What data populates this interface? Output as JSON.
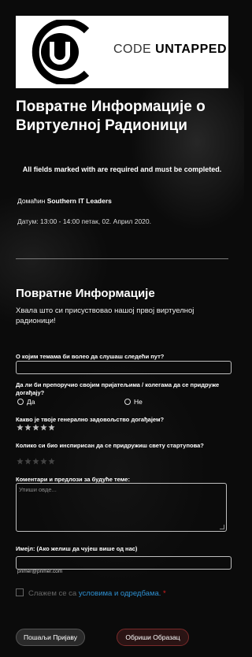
{
  "logo": {
    "word1": "CODE ",
    "word2": "UNTAPPED",
    "mark_letter": "U"
  },
  "header": {
    "title": "Повратне Информације о Виртуелној Радионици",
    "required_note": "All fields marked with are required and must be completed."
  },
  "event": {
    "host_prefix": "Домаћин ",
    "host_name": "Southern IT Leaders",
    "date": "Датум: 13:00 - 14:00 петак, 02. Април 2020."
  },
  "section": {
    "title": "Повратне Информације",
    "description": "Хвала што си присуствовао нашој првој виртуелној радионици!"
  },
  "questions": {
    "topics_label": "О којим темама би волео да слушаш следећи пут?",
    "topics_value": "",
    "recommend_label": "Да ли би препоручио својим пријатељима / колегама да се придруже догађају?",
    "recommend_options": [
      "Да",
      "Не"
    ],
    "satisfaction_label": "Какво је твоје генерално задовољство догађајем?",
    "satisfaction_rating": 5,
    "inspired_label": "Колико си био инспирисан да се придружиш свету стартупова?",
    "inspired_rating": 0,
    "comments_label": "Коментари и предлози за будуће теме:",
    "comments_placeholder": "Упиши овде...",
    "email_label": "Имејл: (Ако желиш да чујеш више од нас)",
    "email_value": "",
    "email_sublabel": "primer@primer.com"
  },
  "agreement": {
    "text": "Слажем се са ",
    "link": "условима и одредбама.",
    "required_mark": "*"
  },
  "buttons": {
    "submit": "Пошаљи Пријаву",
    "reset": "Обриши Образац"
  },
  "colors": {
    "background": "#0b0b0b",
    "link": "#2e8fd0",
    "required": "#e02020",
    "star_active": "#bdbdbd",
    "star_inactive": "#444444"
  }
}
